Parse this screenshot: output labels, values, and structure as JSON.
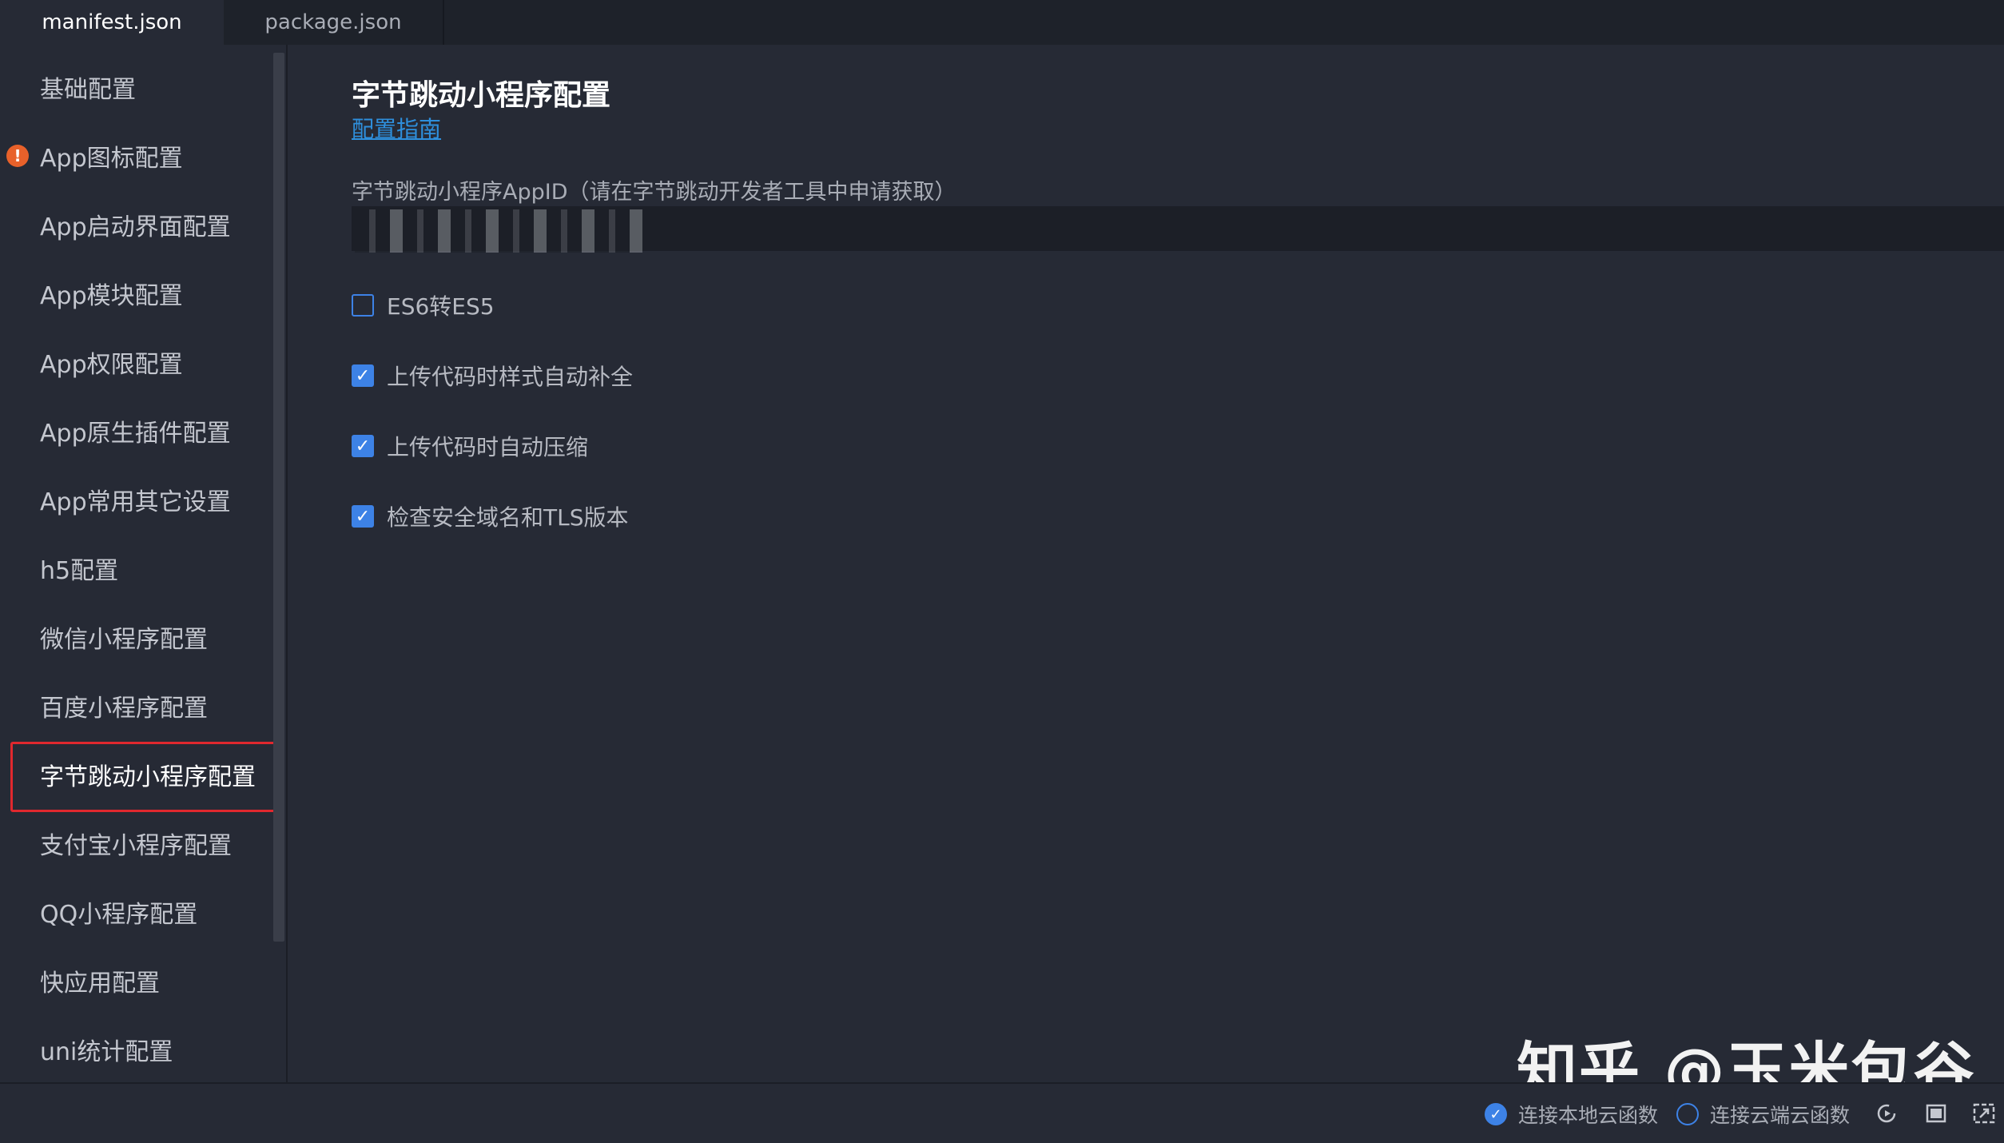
{
  "tabs": [
    {
      "label": "manifest.json",
      "active": true
    },
    {
      "label": "package.json",
      "active": false
    }
  ],
  "sidebar": {
    "items": [
      {
        "label": "基础配置"
      },
      {
        "label": "App图标配置",
        "warning": true
      },
      {
        "label": "App启动界面配置"
      },
      {
        "label": "App模块配置"
      },
      {
        "label": "App权限配置"
      },
      {
        "label": "App原生插件配置"
      },
      {
        "label": "App常用其它设置"
      },
      {
        "label": "h5配置"
      },
      {
        "label": "微信小程序配置"
      },
      {
        "label": "百度小程序配置"
      },
      {
        "label": "字节跳动小程序配置",
        "active": true
      },
      {
        "label": "支付宝小程序配置"
      },
      {
        "label": "QQ小程序配置"
      },
      {
        "label": "快应用配置"
      },
      {
        "label": "uni统计配置"
      }
    ]
  },
  "main": {
    "title": "字节跳动小程序配置",
    "guide_link": "配置指南",
    "appid_label": "字节跳动小程序AppID（请在字节跳动开发者工具中申请获取）",
    "appid_value": "",
    "options": [
      {
        "label": "ES6转ES5",
        "checked": false
      },
      {
        "label": "上传代码时样式自动补全",
        "checked": true
      },
      {
        "label": "上传代码时自动压缩",
        "checked": true
      },
      {
        "label": "检查安全域名和TLS版本",
        "checked": true
      }
    ]
  },
  "watermark": "知乎 @玉米包谷",
  "statusbar": {
    "local_cloud": {
      "label": "连接本地云函数",
      "checked": true
    },
    "remote_cloud": {
      "label": "连接云端云函数",
      "checked": false
    },
    "icons": [
      "refresh-icon",
      "square-icon",
      "expand-icon"
    ]
  },
  "colors": {
    "accent": "#3d82e6",
    "link": "#2e8fdc",
    "highlight_border": "#e0282e",
    "warning": "#e8612a"
  }
}
